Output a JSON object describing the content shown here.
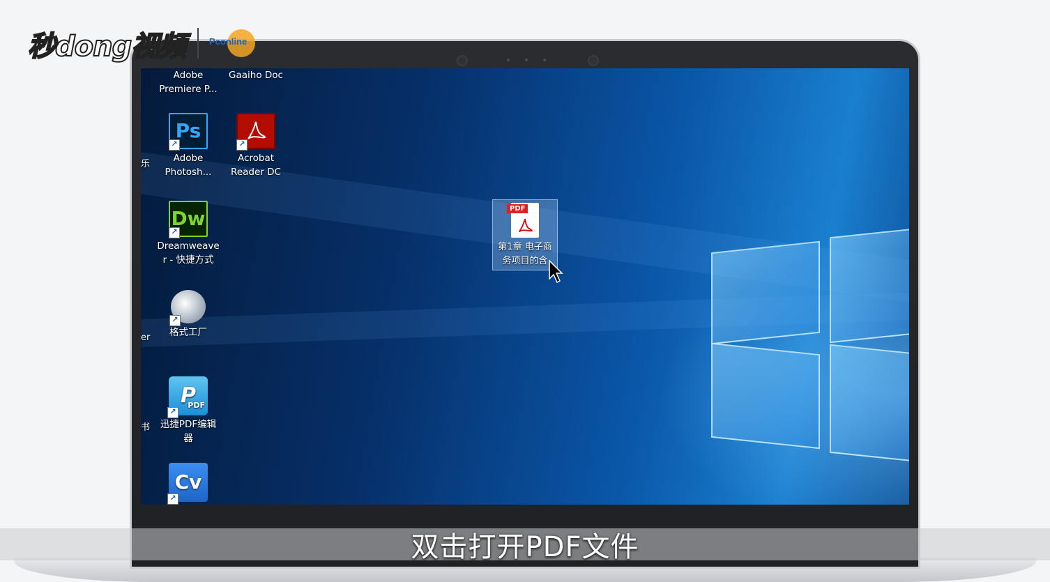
{
  "watermark": {
    "brand": "秒dong视频",
    "partner": "Pconline"
  },
  "desktop": {
    "icons": [
      {
        "label": "Adobe\nPremiere P...",
        "icon": "premiere-icon"
      },
      {
        "label": "Gaaiho Doc",
        "icon": "gaaiho-doc-icon"
      },
      {
        "label": "Adobe\nPhotosh...",
        "icon": "photoshop-icon",
        "glyph": "Ps"
      },
      {
        "label": "Acrobat\nReader DC",
        "icon": "acrobat-reader-icon"
      },
      {
        "label": "Dreamweave\nr - 快捷方式",
        "icon": "dreamweaver-icon",
        "glyph": "Dw"
      },
      {
        "label": "格式工厂",
        "icon": "format-factory-icon"
      },
      {
        "label": "迅捷PDF编辑\n器",
        "icon": "xunjie-pdf-editor-icon",
        "badge": "PDF"
      },
      {
        "label": "",
        "icon": "cv-icon",
        "glyph": "Cv"
      }
    ],
    "selected_file": {
      "label": "第1章 电子商\n务项目的含",
      "icon": "pdf-file-icon",
      "badge": "PDF"
    },
    "partial_labels": [
      "乐",
      "er",
      "书"
    ]
  },
  "subtitle": "双击打开PDF文件",
  "colors": {
    "ps": "#001e36",
    "ps_fg": "#31a8ff",
    "dw": "#072401",
    "dw_fg": "#7cd52a",
    "acrobat": "#b30b00",
    "cv": "#2d7de0"
  }
}
